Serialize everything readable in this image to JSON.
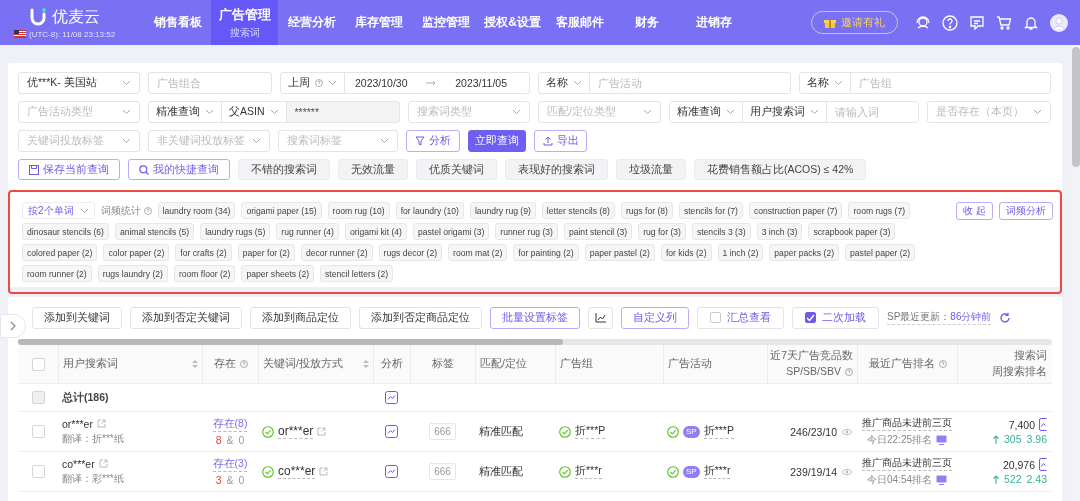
{
  "header": {
    "logo": "优麦云",
    "clock": "(UTC-8): 11/08 23:13:52",
    "nav": [
      {
        "label": "销售看板",
        "selected": false
      },
      {
        "label": "广告管理",
        "sublabel": "搜索词",
        "selected": true
      },
      {
        "label": "经营分析",
        "selected": false
      },
      {
        "label": "库存管理",
        "selected": false
      },
      {
        "label": "监控管理",
        "selected": false
      },
      {
        "label": "授权&设置",
        "selected": false
      },
      {
        "label": "客服邮件",
        "selected": false
      },
      {
        "label": "财务",
        "selected": false
      },
      {
        "label": "进销存",
        "selected": false
      }
    ],
    "invite": "邀请有礼"
  },
  "filters": [
    [
      {
        "kind": "select",
        "value": "优***K- 美国站"
      },
      {
        "kind": "input",
        "placeholder": "广告组合"
      },
      {
        "kind": "group",
        "parts": [
          {
            "kind": "select",
            "value": "上周",
            "help": true
          },
          {
            "kind": "date_range",
            "start": "2023/10/30",
            "end": "2023/11/05"
          }
        ]
      },
      {
        "kind": "group",
        "parts": [
          {
            "kind": "select",
            "value": "名称"
          },
          {
            "kind": "input",
            "placeholder": "广告活动"
          }
        ]
      },
      {
        "kind": "group",
        "parts": [
          {
            "kind": "select",
            "value": "名称"
          },
          {
            "kind": "input",
            "placeholder": "广告组"
          }
        ]
      }
    ],
    [
      {
        "kind": "select",
        "placeholder": "广告活动类型"
      },
      {
        "kind": "group",
        "parts": [
          {
            "kind": "select",
            "value": "精准查询"
          },
          {
            "kind": "select",
            "value": "父ASIN"
          },
          {
            "kind": "readonly",
            "value": "******"
          }
        ]
      },
      {
        "kind": "select",
        "placeholder": "搜索词类型"
      },
      {
        "kind": "select",
        "placeholder": "匹配/定位类型"
      },
      {
        "kind": "group",
        "parts": [
          {
            "kind": "select",
            "value": "精准查询"
          },
          {
            "kind": "select",
            "value": "用户搜索词"
          },
          {
            "kind": "input",
            "placeholder": "请输入词"
          }
        ]
      },
      {
        "kind": "select",
        "placeholder": "是否存在（本页）"
      }
    ],
    [
      {
        "kind": "select",
        "placeholder": "关键词投放标签"
      },
      {
        "kind": "select",
        "placeholder": "非关键词投放标签"
      },
      {
        "kind": "select",
        "placeholder": "搜索词标签"
      },
      {
        "kind": "analyze",
        "label": "分析"
      },
      {
        "kind": "submit",
        "label": "立即查询"
      },
      {
        "kind": "export",
        "label": "导出"
      }
    ]
  ],
  "quick": [
    {
      "kind": "save",
      "label": "保存当前查询"
    },
    {
      "kind": "favorites",
      "label": "我的快捷查询"
    },
    {
      "kind": "chip",
      "label": "不错的搜索词"
    },
    {
      "kind": "chip",
      "label": "无效流量"
    },
    {
      "kind": "chip",
      "label": "优质关键词"
    },
    {
      "kind": "chip",
      "label": "表现好的搜索词"
    },
    {
      "kind": "chip",
      "label": "垃圾流量"
    },
    {
      "kind": "chip",
      "label": "花费销售额占比(ACOS) ≤ 42%"
    }
  ],
  "word_stats": {
    "grouping": "按2个单词",
    "label": "词频统计",
    "words": [
      "laundry room (34)",
      "origami paper (15)",
      "room rug (10)",
      "for laundry (10)",
      "laundry rug (9)",
      "letter stencils (8)",
      "rugs for (8)",
      "stencils for (7)",
      "construction paper (7)",
      "room rugs (7)",
      "dinosaur stencils (6)",
      "animal stencils (5)",
      "laundry rugs (5)",
      "rug runner (4)",
      "origami kit (4)",
      "pastel origami (3)",
      "runner rug (3)",
      "paint stencil (3)",
      "rug for (3)",
      "stencils 3 (3)",
      "3 inch (3)",
      "scrapbook paper (3)",
      "colored paper (2)",
      "color paper (2)",
      "for crafts (2)",
      "paper for (2)",
      "decor runner (2)",
      "rugs decor (2)",
      "room mat (2)",
      "for painting (2)",
      "paper pastel (2)",
      "for kids (2)",
      "1 inch (2)",
      "paper packs (2)",
      "pastel paper (2)",
      "room runner (2)",
      "rugs laundry (2)",
      "room floor (2)",
      "paper sheets (2)",
      "stencil letters (2)"
    ],
    "buttons": [
      "收 起",
      "词频分析"
    ]
  },
  "toolbar": {
    "buttons": [
      {
        "kind": "plain",
        "label": "添加到关键词"
      },
      {
        "kind": "plain",
        "label": "添加到否定关键词"
      },
      {
        "kind": "plain",
        "label": "添加到商品定位"
      },
      {
        "kind": "plain",
        "label": "添加到否定商品定位"
      },
      {
        "kind": "accent",
        "label": "批量设置标签"
      },
      {
        "kind": "chart"
      },
      {
        "kind": "accent",
        "label": "自定义列"
      }
    ],
    "checks": [
      {
        "label": "汇总查看",
        "checked": false
      },
      {
        "label": "二次加载",
        "checked": true
      }
    ],
    "update_label": "SP最近更新：",
    "update_value": "86分钟前"
  },
  "table": {
    "all_checked": false,
    "columns": [
      {
        "label": "用户搜索词",
        "sortable": true
      },
      {
        "label": "存在",
        "help": true
      },
      {
        "label": "关键词/投放方式",
        "sortable": true
      },
      {
        "label": "分析"
      },
      {
        "label": "标签"
      },
      {
        "label": "匹配/定位"
      },
      {
        "label": "广告组"
      },
      {
        "label": "广告活动"
      },
      {
        "label": "近7天广告竞品数",
        "sublabel": "SP/SB/SBV",
        "help": true
      },
      {
        "label": "最近广告排名",
        "help": true
      },
      {
        "label": "搜索词",
        "sublabel": "周搜索排名"
      }
    ],
    "total": {
      "label": "总计(186)",
      "disabled": true
    },
    "rows": [
      {
        "checked": false,
        "term": "or***er",
        "translation": "翻译：折***纸",
        "exists": "存在(8)",
        "count_a": "8",
        "joiner": "&",
        "count_b": "0",
        "keyword": "or***er",
        "tag": "666",
        "match": "精准匹配",
        "ad_group": "折***P",
        "campaign": "折***P",
        "campaign_type": "SP",
        "competitors": "246/23/10",
        "rank": "推广商品未进前三页",
        "rank_time": "今日22:25排名",
        "weekly": "7,400",
        "weekly_change": "305",
        "weekly_pct": "3.96"
      },
      {
        "checked": false,
        "term": "co***er",
        "translation": "翻译：彩***纸",
        "exists": "存在(3)",
        "count_a": "3",
        "joiner": "&",
        "count_b": "0",
        "keyword": "co***er",
        "tag": "666",
        "match": "精准匹配",
        "ad_group": "折***r",
        "campaign": "折***r",
        "campaign_type": "SP",
        "competitors": "239/19/14",
        "rank": "推广商品未进前三页",
        "rank_time": "今日04:54排名",
        "weekly": "20,976",
        "weekly_change": "522",
        "weekly_pct": "2.43"
      }
    ]
  }
}
